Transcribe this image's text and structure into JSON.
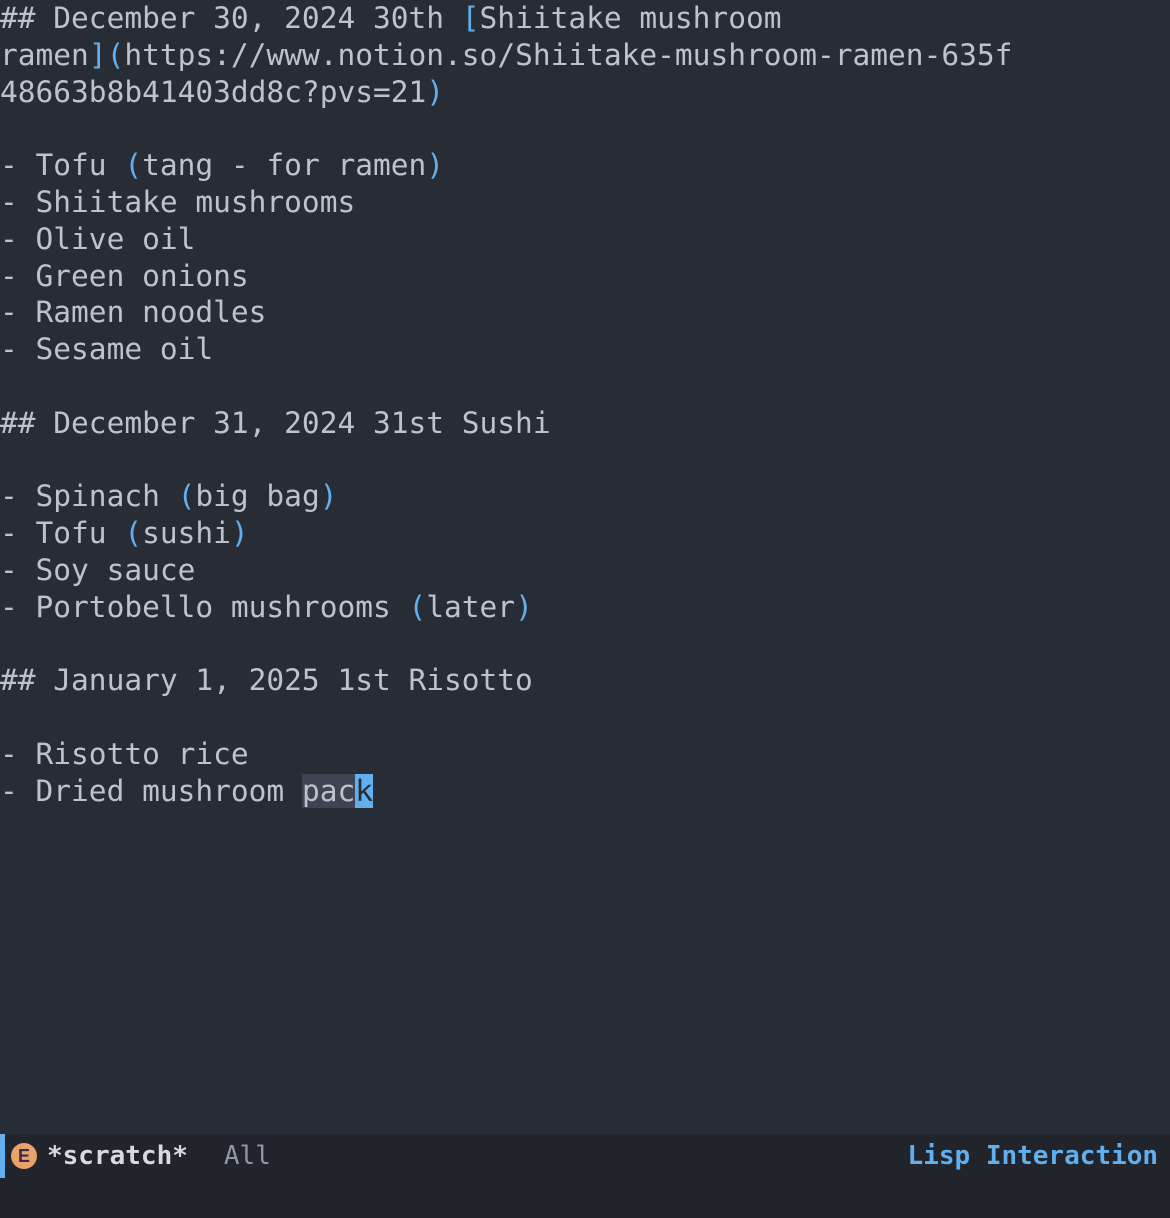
{
  "editor": {
    "lines": [
      {
        "parts": [
          {
            "t": "## December 30, 2024 30th "
          },
          {
            "t": "[",
            "cls": "kw"
          },
          {
            "t": "Shiitake mushroom"
          }
        ]
      },
      {
        "parts": [
          {
            "t": "ramen"
          },
          {
            "t": "](",
            "cls": "kw"
          },
          {
            "t": "https://www.notion.so/Shiitake-mushroom-ramen-635f"
          }
        ]
      },
      {
        "parts": [
          {
            "t": "48663b8b41403dd8c?pvs=21"
          },
          {
            "t": ")",
            "cls": "kw"
          }
        ]
      },
      {
        "parts": [
          {
            "t": ""
          }
        ]
      },
      {
        "parts": [
          {
            "t": "- Tofu "
          },
          {
            "t": "(",
            "cls": "kw"
          },
          {
            "t": "tang - for ramen"
          },
          {
            "t": ")",
            "cls": "kw"
          }
        ]
      },
      {
        "parts": [
          {
            "t": "- Shiitake mushrooms"
          }
        ]
      },
      {
        "parts": [
          {
            "t": "- Olive oil"
          }
        ]
      },
      {
        "parts": [
          {
            "t": "- Green onions"
          }
        ]
      },
      {
        "parts": [
          {
            "t": "- Ramen noodles"
          }
        ]
      },
      {
        "parts": [
          {
            "t": "- Sesame oil"
          }
        ]
      },
      {
        "parts": [
          {
            "t": ""
          }
        ]
      },
      {
        "parts": [
          {
            "t": "## December 31, 2024 31st Sushi"
          }
        ]
      },
      {
        "parts": [
          {
            "t": ""
          }
        ]
      },
      {
        "parts": [
          {
            "t": "- Spinach "
          },
          {
            "t": "(",
            "cls": "kw"
          },
          {
            "t": "big bag"
          },
          {
            "t": ")",
            "cls": "kw"
          }
        ]
      },
      {
        "parts": [
          {
            "t": "- Tofu "
          },
          {
            "t": "(",
            "cls": "kw"
          },
          {
            "t": "sushi"
          },
          {
            "t": ")",
            "cls": "kw"
          }
        ]
      },
      {
        "parts": [
          {
            "t": "- Soy sauce"
          }
        ]
      },
      {
        "parts": [
          {
            "t": "- Portobello mushrooms "
          },
          {
            "t": "(",
            "cls": "kw"
          },
          {
            "t": "later"
          },
          {
            "t": ")",
            "cls": "kw"
          }
        ]
      },
      {
        "parts": [
          {
            "t": ""
          }
        ]
      },
      {
        "parts": [
          {
            "t": "## January 1, 2025 1st Risotto"
          }
        ]
      },
      {
        "parts": [
          {
            "t": ""
          }
        ]
      },
      {
        "parts": [
          {
            "t": "- Risotto rice"
          }
        ]
      },
      {
        "parts": [
          {
            "t": "- Dried mushroom "
          },
          {
            "t": "pac",
            "cls": "region"
          },
          {
            "t": "k",
            "cls": "cursor"
          }
        ]
      }
    ]
  },
  "modeline": {
    "logo_glyph": "E",
    "buffer_name": "*scratch*",
    "position": "All",
    "major_mode": "Lisp Interaction"
  }
}
